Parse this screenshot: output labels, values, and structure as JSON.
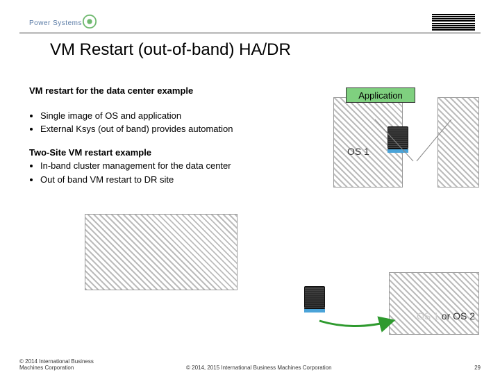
{
  "header": {
    "brand_label": "Power Systems",
    "ibm_alt": "IBM"
  },
  "title": "VM Restart  (out-of-band) HA/DR",
  "section1": {
    "heading": "VM restart for the data center example",
    "bullets": [
      "Single image of OS and application",
      "External Ksys (out of band) provides automation"
    ]
  },
  "section2": {
    "heading": "Two-Site VM restart example",
    "bullets": [
      "In-band cluster management for the data center",
      "Out of band VM restart to DR site"
    ]
  },
  "diagram": {
    "application_label": "Application",
    "os_primary_label": "OS 1",
    "os_dr_label_fragment": "or OS 2",
    "os_dr_label_hidden": "OS 1"
  },
  "footer": {
    "copyright_short": "© 2014 International Business Machines Corporation",
    "copyright_long": "© 2014, 2015 International Business Machines Corporation",
    "page_number": "29"
  }
}
